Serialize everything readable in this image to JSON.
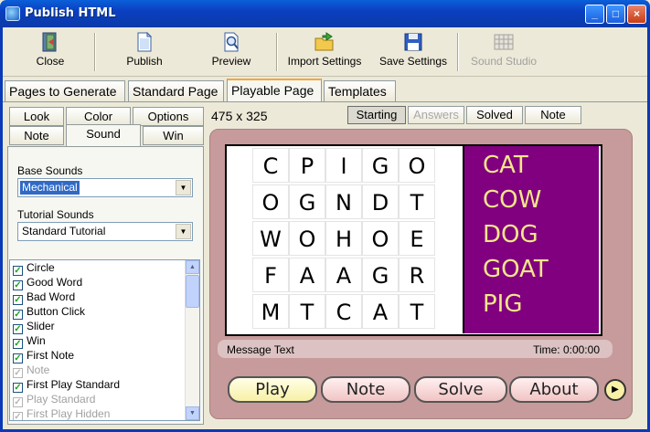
{
  "window": {
    "title": "Publish HTML",
    "controls": [
      "_",
      "□",
      "×"
    ]
  },
  "toolbar": [
    {
      "label": "Close",
      "icon": "close-door-icon",
      "enabled": true
    },
    {
      "label": "Publish",
      "icon": "document-icon",
      "enabled": true
    },
    {
      "label": "Preview",
      "icon": "magnifier-icon",
      "enabled": true
    },
    {
      "label": "Import Settings",
      "icon": "folder-import-icon",
      "enabled": true
    },
    {
      "label": "Save Settings",
      "icon": "floppy-disk-icon",
      "enabled": true
    },
    {
      "label": "Sound Studio",
      "icon": "grid-icon",
      "enabled": false
    }
  ],
  "main_tabs": [
    "Pages to Generate",
    "Standard Page",
    "Playable Page",
    "Templates"
  ],
  "main_tab_active": "Playable Page",
  "sub_tabs_row1": [
    "Look",
    "Color",
    "Options"
  ],
  "sub_tabs_row2": [
    "Note",
    "Sound",
    "Win"
  ],
  "sub_tab_active": "Sound",
  "page_size": "475 x 325",
  "preview_tabs": [
    "Starting",
    "Answers",
    "Solved",
    "Note"
  ],
  "preview_tab_active": "Starting",
  "preview_tab_disabled": "Answers",
  "sound_panel": {
    "base_sounds_label": "Base Sounds",
    "base_sounds_value": "Mechanical",
    "tutorial_sounds_label": "Tutorial Sounds",
    "tutorial_sounds_value": "Standard Tutorial"
  },
  "sound_events": [
    {
      "label": "Circle",
      "checked": true,
      "enabled": true
    },
    {
      "label": "Good Word",
      "checked": true,
      "enabled": true
    },
    {
      "label": "Bad Word",
      "checked": true,
      "enabled": true
    },
    {
      "label": "Button Click",
      "checked": true,
      "enabled": true
    },
    {
      "label": "Slider",
      "checked": true,
      "enabled": true
    },
    {
      "label": "Win",
      "checked": true,
      "enabled": true
    },
    {
      "label": "First Note",
      "checked": true,
      "enabled": true
    },
    {
      "label": "Note",
      "checked": true,
      "enabled": false
    },
    {
      "label": "First Play Standard",
      "checked": true,
      "enabled": true
    },
    {
      "label": "Play Standard",
      "checked": true,
      "enabled": false
    },
    {
      "label": "First Play Hidden",
      "checked": true,
      "enabled": false
    }
  ],
  "puzzle": {
    "grid": [
      [
        "C",
        "P",
        "I",
        "G",
        "O"
      ],
      [
        "O",
        "G",
        "N",
        "D",
        "T"
      ],
      [
        "W",
        "O",
        "H",
        "O",
        "E"
      ],
      [
        "F",
        "A",
        "A",
        "G",
        "R"
      ],
      [
        "M",
        "T",
        "C",
        "A",
        "T"
      ]
    ],
    "words": [
      "CAT",
      "COW",
      "DOG",
      "GOAT",
      "PIG"
    ],
    "message": "Message Text",
    "time": "Time: 0:00:00",
    "buttons": [
      "Play",
      "Note",
      "Solve",
      "About"
    ]
  },
  "colors": {
    "game_bg": "#c79b9b",
    "word_panel": "#800080",
    "word_text": "#f5e68a",
    "titlebar": "#0a4fd0"
  }
}
